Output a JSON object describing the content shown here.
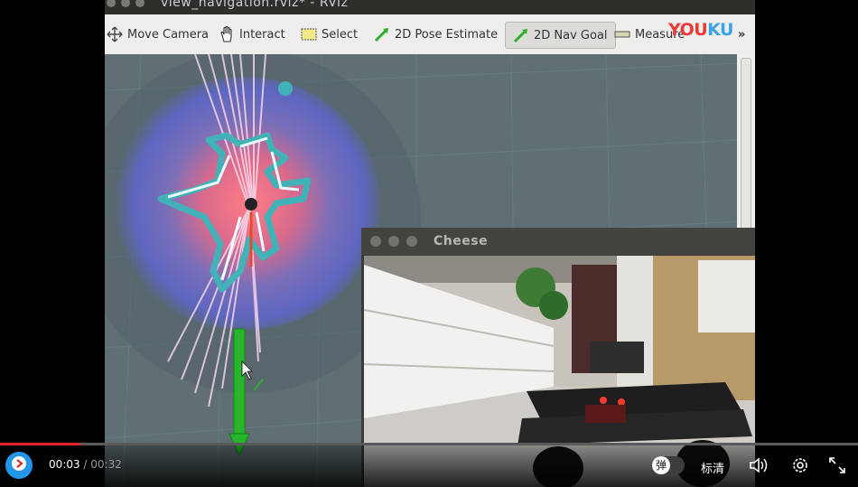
{
  "window": {
    "title": "view_navigation.rviz* - RViz"
  },
  "toolbar": {
    "tools": [
      {
        "label": "Move Camera",
        "icon": "move-camera-icon"
      },
      {
        "label": "Interact",
        "icon": "hand-icon"
      },
      {
        "label": "Select",
        "icon": "select-icon"
      },
      {
        "label": "2D Pose Estimate",
        "icon": "green-arrow-icon"
      },
      {
        "label": "2D Nav Goal",
        "icon": "green-arrow-icon",
        "active": true
      },
      {
        "label": "Measure",
        "icon": "ruler-icon"
      }
    ],
    "overflow": "»"
  },
  "watermark": {
    "part1": "YOU",
    "part2": "KU"
  },
  "cheese": {
    "title": "Cheese"
  },
  "player": {
    "current_time": "00:03",
    "separator": " / ",
    "duration": "00:32",
    "progress_fraction": 0.094,
    "danmu_label": "弹",
    "quality_label": "标清"
  },
  "colors": {
    "accent_red": "#e1262f",
    "play_blue": "#2496ea",
    "youku_red": "#e93a38",
    "youku_blue": "#3aa5e6"
  }
}
